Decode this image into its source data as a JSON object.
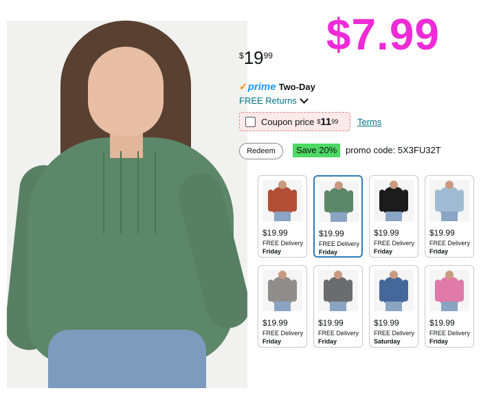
{
  "deal_price": "$7.99",
  "price": {
    "symbol": "$",
    "whole": "19",
    "fraction": "99"
  },
  "prime": {
    "check": "✓",
    "brand": "prime",
    "label": "Two-Day"
  },
  "returns": {
    "label": "FREE Returns"
  },
  "coupon": {
    "label": "Coupon price",
    "symbol": "$",
    "whole": "11",
    "fraction": "99",
    "terms": "Terms"
  },
  "promo": {
    "redeem_label": "Redeem",
    "save_badge": "Save 20%",
    "code_text": "promo code: 5X3FU32T"
  },
  "colors": {
    "deal": "#ee2bd6",
    "link": "#007185",
    "prime": "#1a98ff",
    "save": "#4cd964",
    "selected": "#2f79b8"
  },
  "variants": [
    {
      "price": "$19.99",
      "delivery": "FREE Delivery",
      "day": "Friday",
      "color": "#b24e35",
      "selected": false
    },
    {
      "price": "$19.99",
      "delivery": "FREE Delivery",
      "day": "Friday",
      "color": "#5c8768",
      "selected": true
    },
    {
      "price": "$19.99",
      "delivery": "FREE Delivery",
      "day": "Friday",
      "color": "#1c1c1c",
      "selected": false
    },
    {
      "price": "$19.99",
      "delivery": "FREE Delivery",
      "day": "Friday",
      "color": "#9fbcd4",
      "selected": false
    },
    {
      "price": "$19.99",
      "delivery": "FREE Delivery",
      "day": "Friday",
      "color": "#8f8c89",
      "selected": false
    },
    {
      "price": "$19.99",
      "delivery": "FREE Delivery",
      "day": "Friday",
      "color": "#6a6c6e",
      "selected": false
    },
    {
      "price": "$19.99",
      "delivery": "FREE Delivery",
      "day": "Saturday",
      "color": "#45679a",
      "selected": false
    },
    {
      "price": "$19.99",
      "delivery": "FREE Delivery",
      "day": "Friday",
      "color": "#e07aa8",
      "selected": false
    }
  ]
}
